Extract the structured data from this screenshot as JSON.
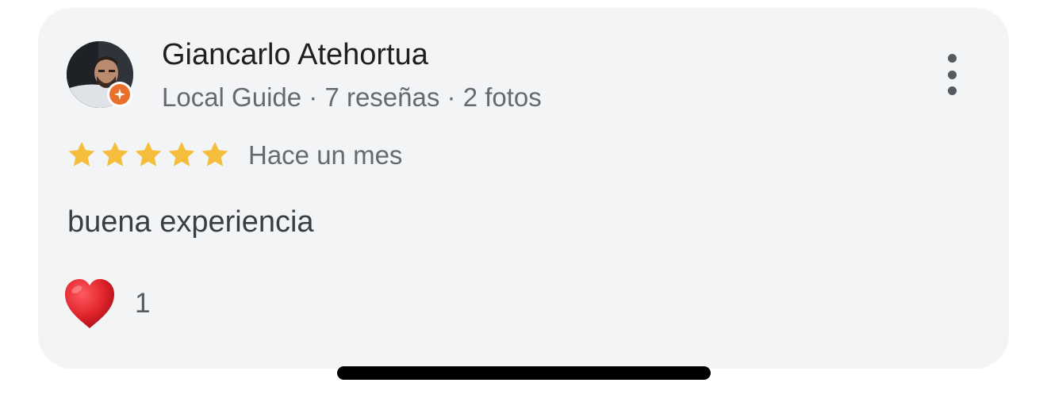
{
  "review": {
    "author_name": "Giancarlo Atehortua",
    "author_meta": "Local Guide · 7 reseñas · 2 fotos",
    "rating": 5,
    "rating_max": 5,
    "time": "Hace un mes",
    "text": "buena experiencia",
    "reactions": {
      "icon": "red-heart-icon",
      "count": "1"
    },
    "more_icon": "more-vertical-icon",
    "badge_icon": "local-guide-star-icon"
  },
  "colors": {
    "card_bg": "#f3f4f6",
    "star": "#f4be3c",
    "badge": "#e8702a",
    "heart": "#d9232e"
  }
}
